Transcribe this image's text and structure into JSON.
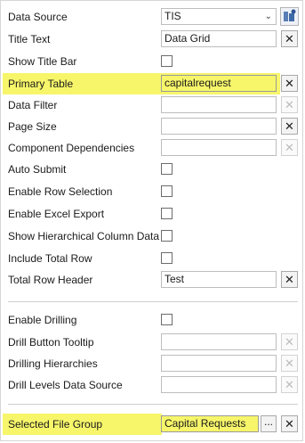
{
  "properties": [
    {
      "label": "Data Source",
      "type": "select",
      "value": "TIS"
    },
    {
      "label": "Title Text",
      "type": "text",
      "value": "Data Grid"
    },
    {
      "label": "Show Title Bar",
      "type": "checkbox"
    },
    {
      "label": "Primary Table",
      "type": "text",
      "value": "capitalrequest"
    },
    {
      "label": "Data Filter",
      "type": "text",
      "value": ""
    },
    {
      "label": "Page Size",
      "type": "text",
      "value": ""
    },
    {
      "label": "Component Dependencies",
      "type": "text",
      "value": ""
    },
    {
      "label": "Auto Submit",
      "type": "checkbox"
    },
    {
      "label": "Enable Row Selection",
      "type": "checkbox"
    },
    {
      "label": "Enable Excel Export",
      "type": "checkbox"
    },
    {
      "label": "Show Hierarchical Column Data",
      "type": "checkbox"
    },
    {
      "label": "Include Total Row",
      "type": "checkbox"
    },
    {
      "label": "Total Row Header",
      "type": "text",
      "value": "Test"
    },
    {
      "label": "Enable Drilling",
      "type": "checkbox"
    },
    {
      "label": "Drill Button Tooltip",
      "type": "text",
      "value": ""
    },
    {
      "label": "Drilling Hierarchies",
      "type": "text",
      "value": ""
    },
    {
      "label": "Drill Levels Data Source",
      "type": "text",
      "value": ""
    },
    {
      "label": "Selected File Group",
      "type": "text",
      "value": "Capital Requests"
    }
  ],
  "buttons": {
    "clear_symbol": "✕",
    "browse_symbol": "...",
    "dropdown_symbol": "⌄"
  },
  "colors": {
    "highlight": "#f7f66a",
    "border": "#bdbdbd"
  },
  "icons": {
    "data_source_button": "data-source-tool-icon"
  }
}
